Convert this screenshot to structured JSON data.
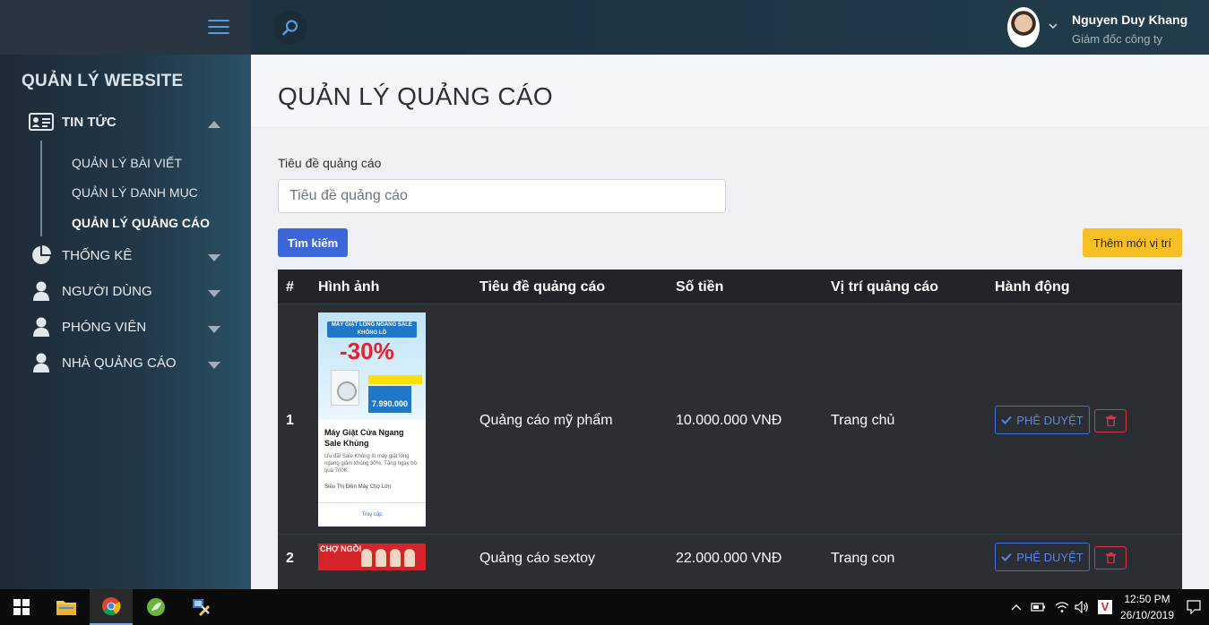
{
  "topbar": {
    "user_name": "Nguyen Duy Khang",
    "user_role": "Giám đốc công ty"
  },
  "sidebar": {
    "brand": "QUẢN LÝ WEBSITE",
    "items": [
      {
        "label": "TIN TỨC",
        "icon": "id-card-icon",
        "expanded": true
      },
      {
        "label": "THỐNG KÊ",
        "icon": "pie-chart-icon",
        "expanded": false
      },
      {
        "label": "NGƯỜI DÙNG",
        "icon": "user-icon",
        "expanded": false
      },
      {
        "label": "PHÓNG VIÊN",
        "icon": "user-icon",
        "expanded": false
      },
      {
        "label": "NHÀ QUẢNG CÁO",
        "icon": "user-icon",
        "expanded": false
      }
    ],
    "subitems": [
      {
        "label": "QUẢN LÝ BÀI VIẾT",
        "active": false
      },
      {
        "label": "QUẢN LÝ DANH MỤC",
        "active": false
      },
      {
        "label": "QUẢN LÝ QUẢNG CÁO",
        "active": true
      }
    ]
  },
  "page": {
    "title": "QUẢN LÝ QUẢNG CÁO",
    "search_label": "Tiêu đề quảng cáo",
    "search_placeholder": "Tiêu đề quảng cáo",
    "search_value": "",
    "search_button": "Tìm kiếm",
    "add_button": "Thêm mới vị trí"
  },
  "table": {
    "headers": [
      "#",
      "Hình ảnh",
      "Tiêu đề quảng cáo",
      "Số tiền",
      "Vị trí quảng cáo",
      "Hành động"
    ],
    "rows": [
      {
        "num": "1",
        "title": "Quảng cáo mỹ phẩm",
        "amount": "10.000.000 VNĐ",
        "position": "Trang chủ",
        "approve": "PHÊ DUYỆT"
      },
      {
        "num": "2",
        "title": "Quảng cáo sextoy",
        "amount": "22.000.000 VNĐ",
        "position": "Trang con",
        "approve": "PHÊ DUYỆT"
      }
    ]
  },
  "ads": {
    "ad1": {
      "headline": "MÁY GIẶT LỒNG NGANG SALE KHỔNG LỒ",
      "discount": "-30%",
      "price": "7.990.000",
      "title": "Máy Giặt Cửa Ngang Sale Khủng",
      "desc": "Ưu đãi Sale Khủng lồ máy giặt lồng ngang giảm khủng 30%. Tặng ngay bộ quà 700K",
      "shop": "Siêu Thị Điện Máy Chợ Lớn",
      "cta": "Truy cập"
    },
    "ad2": {
      "text": "CHỢ NGỒI"
    }
  },
  "taskbar": {
    "time": "12:50 PM",
    "date": "26/10/2019",
    "tray_app_letter": "V"
  },
  "colors": {
    "primary": "#3b67d8",
    "warning": "#f6bf25",
    "danger": "#d9364a",
    "table_dark": "#2b2f33",
    "accent_blue": "#4d9de8"
  }
}
